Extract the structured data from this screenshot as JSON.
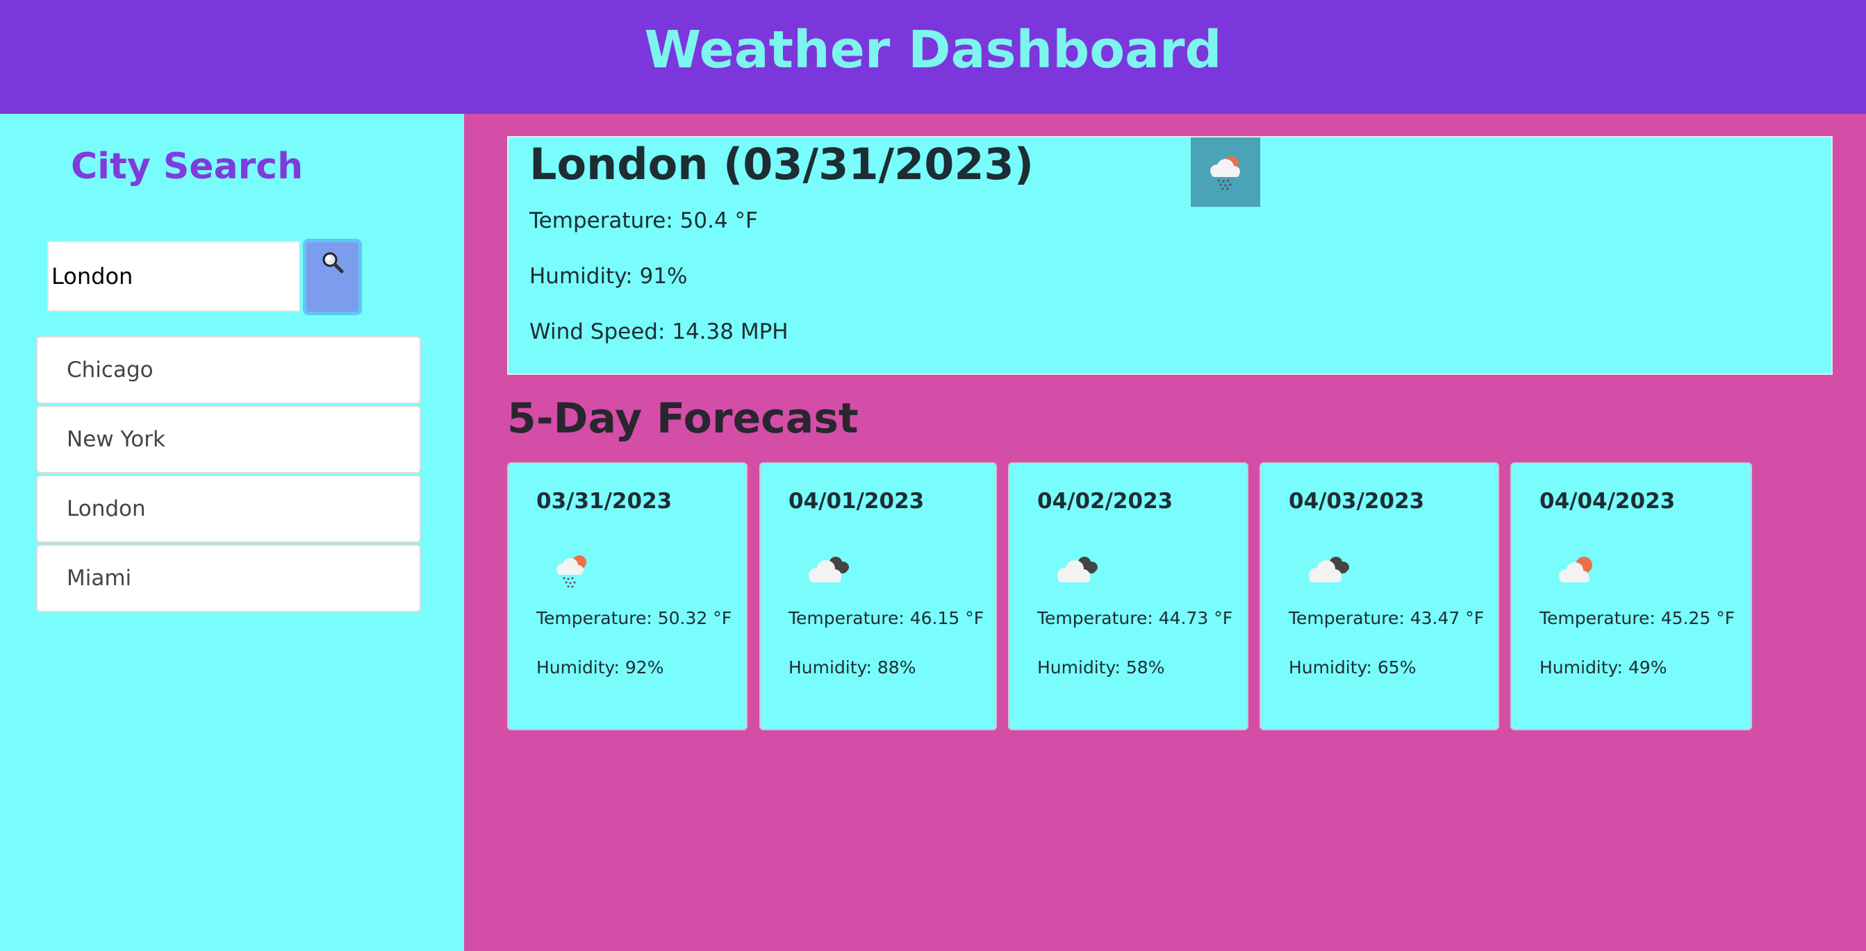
{
  "header": {
    "title": "Weather Dashboard"
  },
  "sidebar": {
    "title": "City Search",
    "search": {
      "value": "London",
      "button_icon": "magnifying-glass-icon"
    },
    "history": [
      "Chicago",
      "New York",
      "London",
      "Miami"
    ]
  },
  "current": {
    "title": "London (03/31/2023)",
    "icon": "rain-cloud-sun-icon",
    "temperature": "Temperature: 50.4 °F",
    "humidity": "Humidity: 91%",
    "wind": "Wind Speed: 14.38 MPH"
  },
  "forecast": {
    "title": "5-Day Forecast",
    "days": [
      {
        "date": "03/31/2023",
        "icon": "rain-cloud-sun-icon",
        "temperature": "Temperature: 50.32 °F",
        "humidity": "Humidity: 92%"
      },
      {
        "date": "04/01/2023",
        "icon": "broken-clouds-icon",
        "temperature": "Temperature: 46.15 °F",
        "humidity": "Humidity: 88%"
      },
      {
        "date": "04/02/2023",
        "icon": "broken-clouds-icon",
        "temperature": "Temperature: 44.73 °F",
        "humidity": "Humidity: 58%"
      },
      {
        "date": "04/03/2023",
        "icon": "broken-clouds-icon",
        "temperature": "Temperature: 43.47 °F",
        "humidity": "Humidity: 65%"
      },
      {
        "date": "04/04/2023",
        "icon": "few-clouds-sun-icon",
        "temperature": "Temperature: 45.25 °F",
        "humidity": "Humidity: 49%"
      }
    ]
  },
  "colors": {
    "header_bg": "#7b37db",
    "header_text": "#7cf5ef",
    "sidebar_bg": "#78fcfc",
    "main_bg": "#d44ea8",
    "card_bg": "#78fcfc",
    "accent_purple": "#7f3bdc",
    "search_button": "#7c9ded"
  }
}
